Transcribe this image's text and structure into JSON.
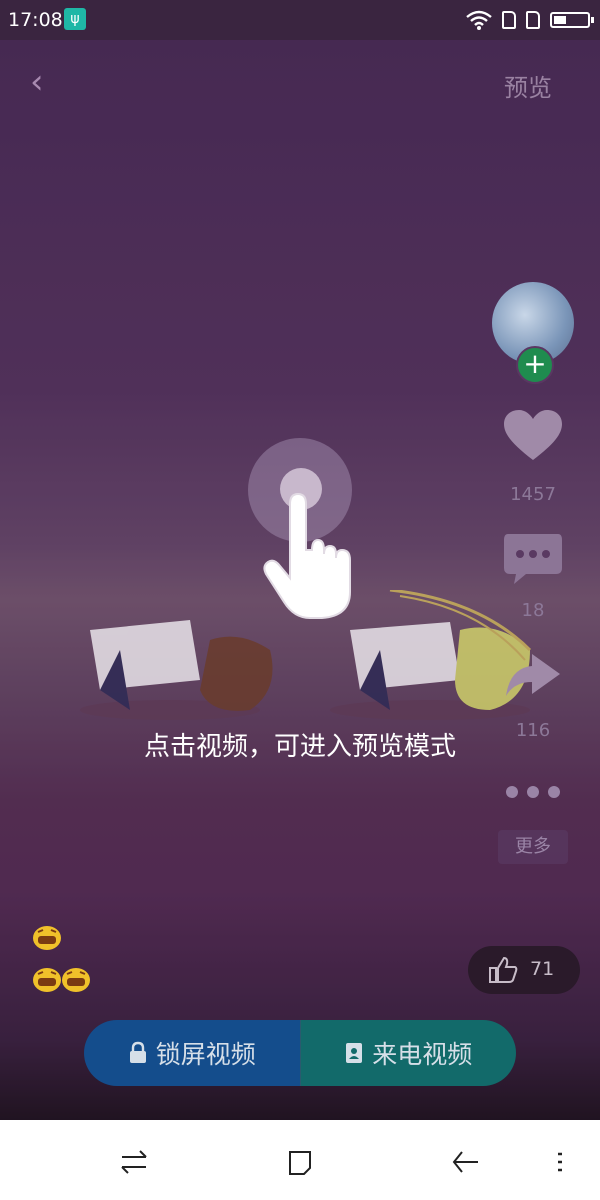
{
  "status_bar": {
    "time": "17:08",
    "usb_icon": "usb-icon",
    "icons": [
      "wifi-icon",
      "sim1-icon",
      "sim2-icon",
      "battery-icon"
    ]
  },
  "header": {
    "back_icon": "back-chevron-icon",
    "preview_label": "预览"
  },
  "right_rail": {
    "like_count": "1457",
    "comment_count": "18",
    "share_count": "116",
    "more_label": "更多"
  },
  "tap_hint": {
    "text": "点击视频，可进入预览模式"
  },
  "like_pill": {
    "count": "71"
  },
  "bottom_actions": {
    "lockscreen_label": "锁屏视频",
    "callvideo_label": "来电视频"
  },
  "colors": {
    "lockscreen_button": "#144d8c",
    "callvideo_button": "#126a6a",
    "follow_badge": "#1f8c4f"
  }
}
